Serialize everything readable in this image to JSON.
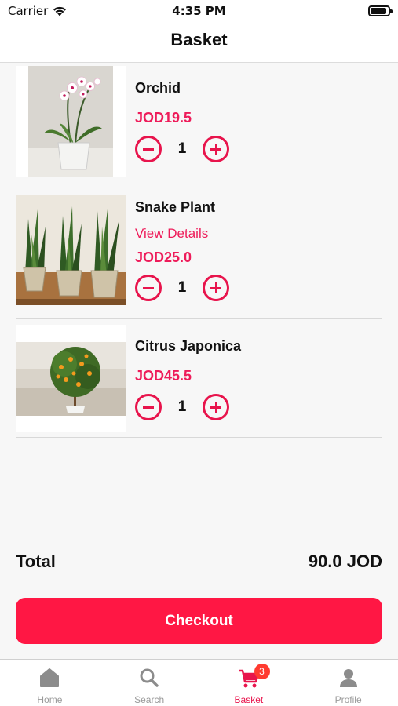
{
  "status_bar": {
    "carrier": "Carrier",
    "time": "4:35 PM",
    "battery_level": 0.9
  },
  "header": {
    "title": "Basket"
  },
  "items": [
    {
      "name": "Orchid",
      "price": "JOD19.5",
      "quantity": "1",
      "image": "orchid-image"
    },
    {
      "name": "Snake Plant",
      "details_link": "View Details",
      "price": "JOD25.0",
      "quantity": "1",
      "image": "snake-plant-image"
    },
    {
      "name": "Citrus Japonica",
      "price": "JOD45.5",
      "quantity": "1",
      "image": "citrus-tree-image"
    }
  ],
  "total": {
    "label": "Total",
    "value": "90.0 JOD"
  },
  "checkout": {
    "label": "Checkout"
  },
  "tabs": [
    {
      "label": "Home",
      "icon": "home-icon"
    },
    {
      "label": "Search",
      "icon": "search-icon"
    },
    {
      "label": "Basket",
      "icon": "cart-icon",
      "badge": "3",
      "active": true
    },
    {
      "label": "Profile",
      "icon": "profile-icon"
    }
  ],
  "colors": {
    "accent": "#e8144c",
    "checkout": "#ff1744",
    "badge": "#ff3b30"
  }
}
